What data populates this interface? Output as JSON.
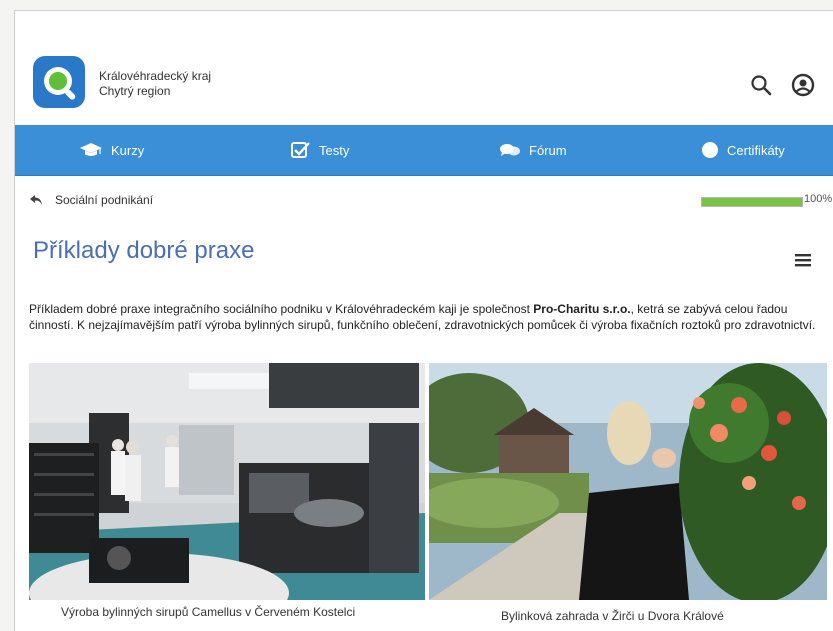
{
  "header": {
    "brand_line1": "Královéhradecký kraj",
    "brand_line2": "Chytrý region",
    "logo_icon": "magnifier-logo-icon",
    "search_icon": "search-icon",
    "user_icon": "user-icon"
  },
  "nav": {
    "items": [
      {
        "label": "Kurzy",
        "icon": "graduation-cap-icon"
      },
      {
        "label": "Testy",
        "icon": "checkbox-icon"
      },
      {
        "label": "Fórum",
        "icon": "chat-bubbles-icon"
      },
      {
        "label": "Certifikáty",
        "icon": "certificate-badge-icon"
      }
    ]
  },
  "breadcrumb": {
    "label": "Sociální podnikání",
    "icon": "back-arrow-icon"
  },
  "progress": {
    "value_percent": 100,
    "label": "100%"
  },
  "page": {
    "title": "Příklady dobré praxe",
    "menu_icon": "hamburger-menu-icon",
    "intro_before": "Příkladem dobré praxe integračního sociálního podniku v Královéhradeckém kaji je společnost ",
    "intro_bold": "Pro-Charitu s.r.o.",
    "intro_after": ", ketrá se zabývá celou řadou činností. K nejzajímavějším patří výroba bylinných sirupů, funkčního oblečení, zdravotnických pomůcek či výroba fixačních roztoků pro zdravotnictví."
  },
  "photos": [
    {
      "caption": "Výroba bylinných sirupů Camellus v Červeném Kostelci"
    },
    {
      "caption": "Bylinková zahrada v Žirči u Dvora Králové"
    }
  ],
  "colors": {
    "nav_bg": "#3a8fd6",
    "title": "#4a6fb5",
    "progress": "#7cc242",
    "logo_blue": "#2a78c8",
    "logo_green": "#5fbf3a"
  }
}
